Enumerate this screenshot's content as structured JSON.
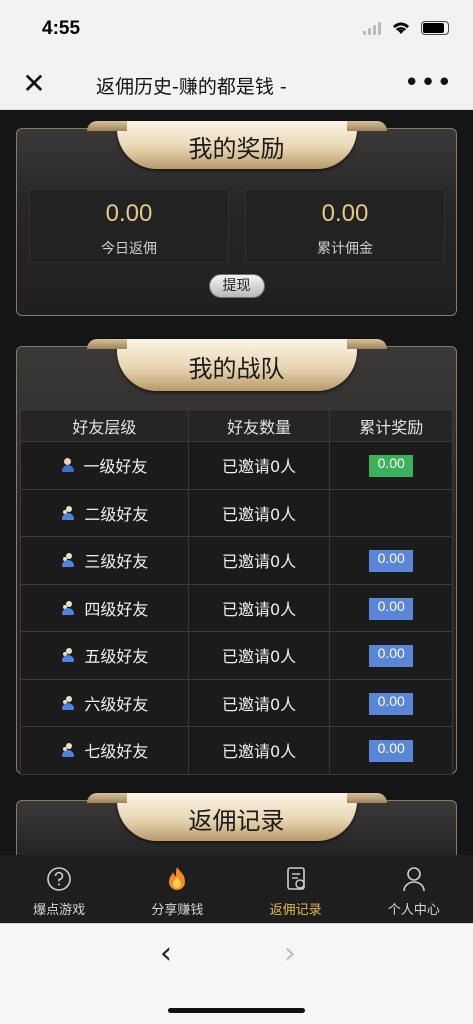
{
  "status": {
    "time": "4:55"
  },
  "nav": {
    "title": "返佣历史-赚的都是钱 -",
    "close_icon": "close-icon",
    "more_icon": "more-icon"
  },
  "rewards": {
    "title": "我的奖励",
    "today": {
      "value": "0.00",
      "label": "今日返佣"
    },
    "total": {
      "value": "0.00",
      "label": "累计佣金"
    },
    "withdraw_label": "提现"
  },
  "team": {
    "title": "我的战队",
    "headers": [
      "好友层级",
      "好友数量",
      "累计奖励"
    ],
    "rows": [
      {
        "level": "一级好友",
        "count": "已邀请0人",
        "reward": "0.00",
        "reward_color": "#3bb15b"
      },
      {
        "level": "二级好友",
        "count": "已邀请0人",
        "reward": "",
        "reward_color": ""
      },
      {
        "level": "三级好友",
        "count": "已邀请0人",
        "reward": "0.00",
        "reward_color": "#5a86d8"
      },
      {
        "level": "四级好友",
        "count": "已邀请0人",
        "reward": "0.00",
        "reward_color": "#5a86d8"
      },
      {
        "level": "五级好友",
        "count": "已邀请0人",
        "reward": "0.00",
        "reward_color": "#5a86d8"
      },
      {
        "level": "六级好友",
        "count": "已邀请0人",
        "reward": "0.00",
        "reward_color": "#5a86d8"
      },
      {
        "level": "七级好友",
        "count": "已邀请0人",
        "reward": "0.00",
        "reward_color": "#5a86d8"
      }
    ]
  },
  "records": {
    "title": "返佣记录"
  },
  "tabbar": {
    "items": [
      {
        "label": "爆点游戏",
        "icon": "question-circle-icon"
      },
      {
        "label": "分享赚钱",
        "icon": "flame-icon"
      },
      {
        "label": "返佣记录",
        "icon": "record-icon",
        "active": true
      },
      {
        "label": "个人中心",
        "icon": "user-icon"
      }
    ],
    "active_color": "#e6b64c"
  }
}
